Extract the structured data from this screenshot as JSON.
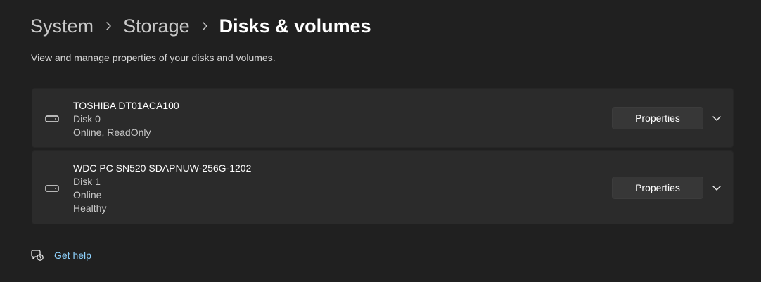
{
  "breadcrumb": {
    "items": [
      "System",
      "Storage",
      "Disks & volumes"
    ],
    "separator_icon": "chevron-right-icon"
  },
  "subtitle": "View and manage properties of your disks and volumes.",
  "disks": [
    {
      "name": "TOSHIBA DT01ACA100",
      "lines": [
        "Disk 0",
        "Online, ReadOnly"
      ],
      "button_label": "Properties",
      "icon": "disk-drive-icon",
      "expand_icon": "chevron-down-icon"
    },
    {
      "name": "WDC PC SN520 SDAPNUW-256G-1202",
      "lines": [
        "Disk 1",
        "Online",
        "Healthy"
      ],
      "button_label": "Properties",
      "icon": "disk-drive-icon",
      "expand_icon": "chevron-down-icon"
    }
  ],
  "help": {
    "label": "Get help",
    "icon": "help-chat-icon"
  },
  "colors": {
    "background": "#202020",
    "card": "#2b2b2b",
    "button": "#373737",
    "link": "#8fd3ff"
  }
}
